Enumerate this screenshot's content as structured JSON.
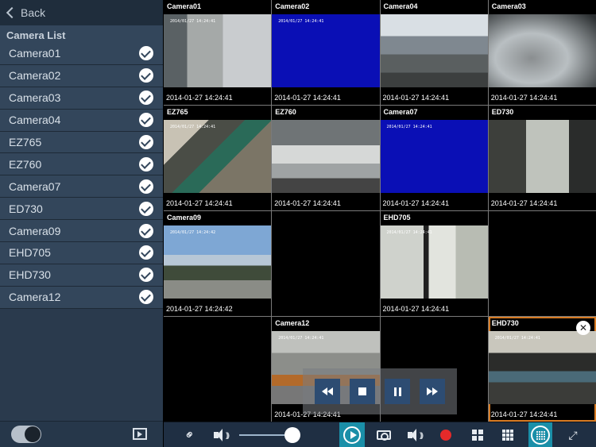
{
  "sidebar": {
    "back_label": "Back",
    "list_title": "Camera List",
    "cameras": [
      {
        "name": "Camera01",
        "checked": true
      },
      {
        "name": "Camera02",
        "checked": true
      },
      {
        "name": "Camera03",
        "checked": true
      },
      {
        "name": "Camera04",
        "checked": true
      },
      {
        "name": "EZ765",
        "checked": true
      },
      {
        "name": "EZ760",
        "checked": true
      },
      {
        "name": "Camera07",
        "checked": true
      },
      {
        "name": "ED730",
        "checked": true
      },
      {
        "name": "Camera09",
        "checked": true
      },
      {
        "name": "EHD705",
        "checked": true
      },
      {
        "name": "EHD730",
        "checked": true
      },
      {
        "name": "Camera12",
        "checked": true
      }
    ]
  },
  "grid": {
    "tiles": [
      {
        "name": "Camera01",
        "timestamp": "2014-01-27 14:24:41",
        "osd": "2014/01/27 14:24:41",
        "video": "cam01"
      },
      {
        "name": "Camera02",
        "timestamp": "2014-01-27 14:24:41",
        "osd": "2014/01/27 14:24:41",
        "video": "cam02"
      },
      {
        "name": "Camera04",
        "timestamp": "2014-01-27 14:24:41",
        "osd": "",
        "video": "cam04"
      },
      {
        "name": "Camera03",
        "timestamp": "2014-01-27 14:24:41",
        "osd": "",
        "video": "cam03"
      },
      {
        "name": "EZ765",
        "timestamp": "2014-01-27 14:24:41",
        "osd": "2014/01/27 14:24:41",
        "video": "ez765"
      },
      {
        "name": "EZ760",
        "timestamp": "2014-01-27 14:24:41",
        "osd": "",
        "video": "ez760"
      },
      {
        "name": "Camera07",
        "timestamp": "2014-01-27 14:24:41",
        "osd": "2014/01/27 14:24:41",
        "video": "cam07"
      },
      {
        "name": "ED730",
        "timestamp": "2014-01-27 14:24:41",
        "osd": "",
        "video": "ed730"
      },
      {
        "name": "Camera09",
        "timestamp": "2014-01-27 14:24:42",
        "osd": "2014/01/27 14:24:42",
        "video": "cam09"
      },
      {
        "name": "",
        "timestamp": "",
        "osd": "",
        "video": ""
      },
      {
        "name": "EHD705",
        "timestamp": "2014-01-27 14:24:41",
        "osd": "2014/01/27 14:24:41",
        "video": "ehd705"
      },
      {
        "name": "",
        "timestamp": "",
        "osd": "",
        "video": ""
      },
      {
        "name": "",
        "timestamp": "",
        "osd": "",
        "video": ""
      },
      {
        "name": "Camera12",
        "timestamp": "2014-01-27 14:24:41",
        "osd": "2014/01/27 14:24:41",
        "video": "cam12"
      },
      {
        "name": "",
        "timestamp": "",
        "osd": "",
        "video": ""
      },
      {
        "name": "EHD730",
        "timestamp": "2014-01-27 14:24:41",
        "osd": "2014/01/27 14:24:41",
        "video": "ehd730",
        "selected": true,
        "close_glyph": "✕"
      }
    ]
  },
  "colors": {
    "accent": "#1a8fa8",
    "selection": "#d77a22",
    "record": "#e52a2a",
    "sidebar_bg": "#33465b",
    "playback_btn": "#2d4c72"
  },
  "toolbar": {
    "volume_level": 0.88,
    "icons": [
      "link-icon",
      "volume-icon",
      "volume-slider",
      "play-icon",
      "camera-snapshot-icon",
      "volume-icon",
      "record-icon",
      "grid-2x2-icon",
      "grid-3x3-icon",
      "grid-4x4-icon",
      "fullscreen-icon"
    ]
  },
  "playback": {
    "buttons": [
      "rewind-icon",
      "stop-icon",
      "pause-icon",
      "fast-forward-icon"
    ]
  }
}
